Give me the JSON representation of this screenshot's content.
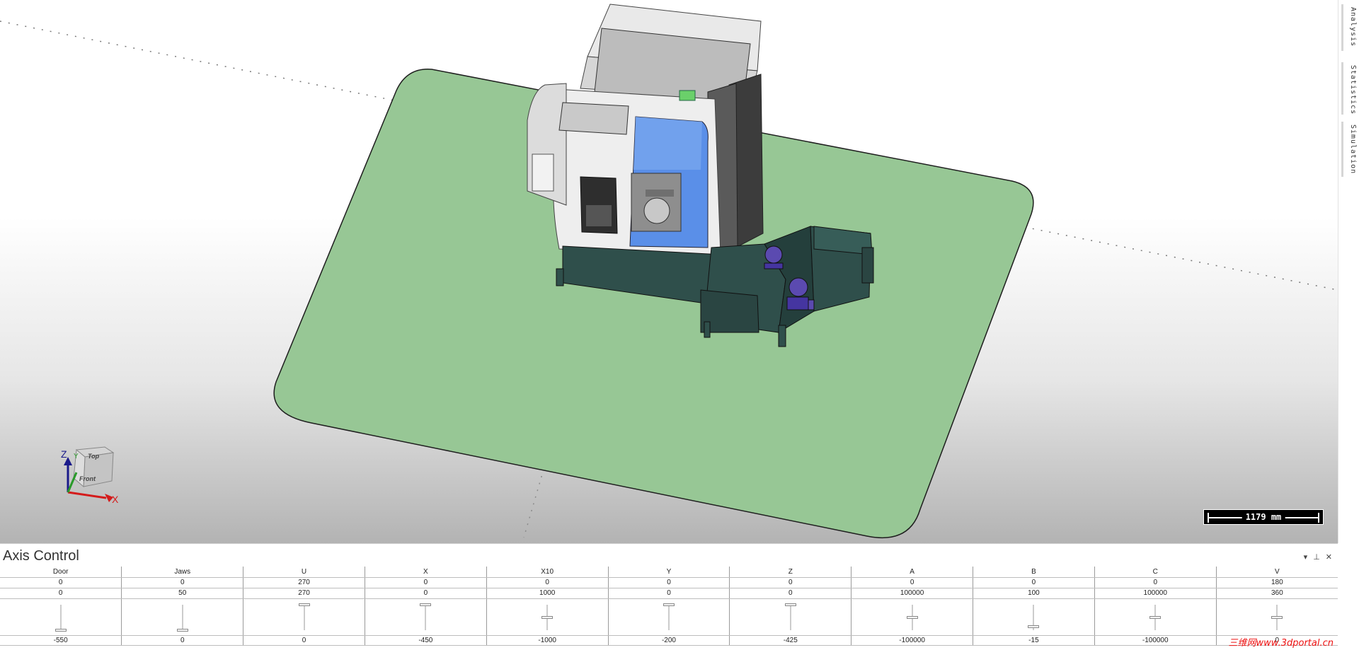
{
  "side_tabs": [
    {
      "label": "Analysis"
    },
    {
      "label": "Statistics"
    },
    {
      "label": "Simulation"
    }
  ],
  "scale_bar": {
    "label": "1179 mm"
  },
  "view_cube": {
    "top": "Top",
    "front": "Front"
  },
  "triad": {
    "z": "Z",
    "y": "Y",
    "x": "X"
  },
  "axis_panel": {
    "title": "Axis Control",
    "columns": [
      {
        "name": "Door",
        "current": "0",
        "max": "0",
        "min": "-550",
        "pos": 0.0
      },
      {
        "name": "Jaws",
        "current": "0",
        "max": "50",
        "min": "0",
        "pos": 0.0
      },
      {
        "name": "U",
        "current": "270",
        "max": "270",
        "min": "0",
        "pos": 1.0
      },
      {
        "name": "X",
        "current": "0",
        "max": "0",
        "min": "-450",
        "pos": 1.0
      },
      {
        "name": "X10",
        "current": "0",
        "max": "1000",
        "min": "-1000",
        "pos": 0.5
      },
      {
        "name": "Y",
        "current": "0",
        "max": "0",
        "min": "-200",
        "pos": 1.0
      },
      {
        "name": "Z",
        "current": "0",
        "max": "0",
        "min": "-425",
        "pos": 1.0
      },
      {
        "name": "A",
        "current": "0",
        "max": "100000",
        "min": "-100000",
        "pos": 0.5
      },
      {
        "name": "B",
        "current": "0",
        "max": "100",
        "min": "-15",
        "pos": 0.13
      },
      {
        "name": "C",
        "current": "0",
        "max": "100000",
        "min": "-100000",
        "pos": 0.5
      },
      {
        "name": "V",
        "current": "180",
        "max": "360",
        "min": "0",
        "pos": 0.5
      }
    ]
  },
  "watermark": {
    "text": "三维网www.3dportal.cn"
  },
  "colors": {
    "floor": "#97c795",
    "machine_base": "#2f4f4b",
    "door_glass": "#5a8fe8",
    "pump": "#5b4ab0"
  }
}
